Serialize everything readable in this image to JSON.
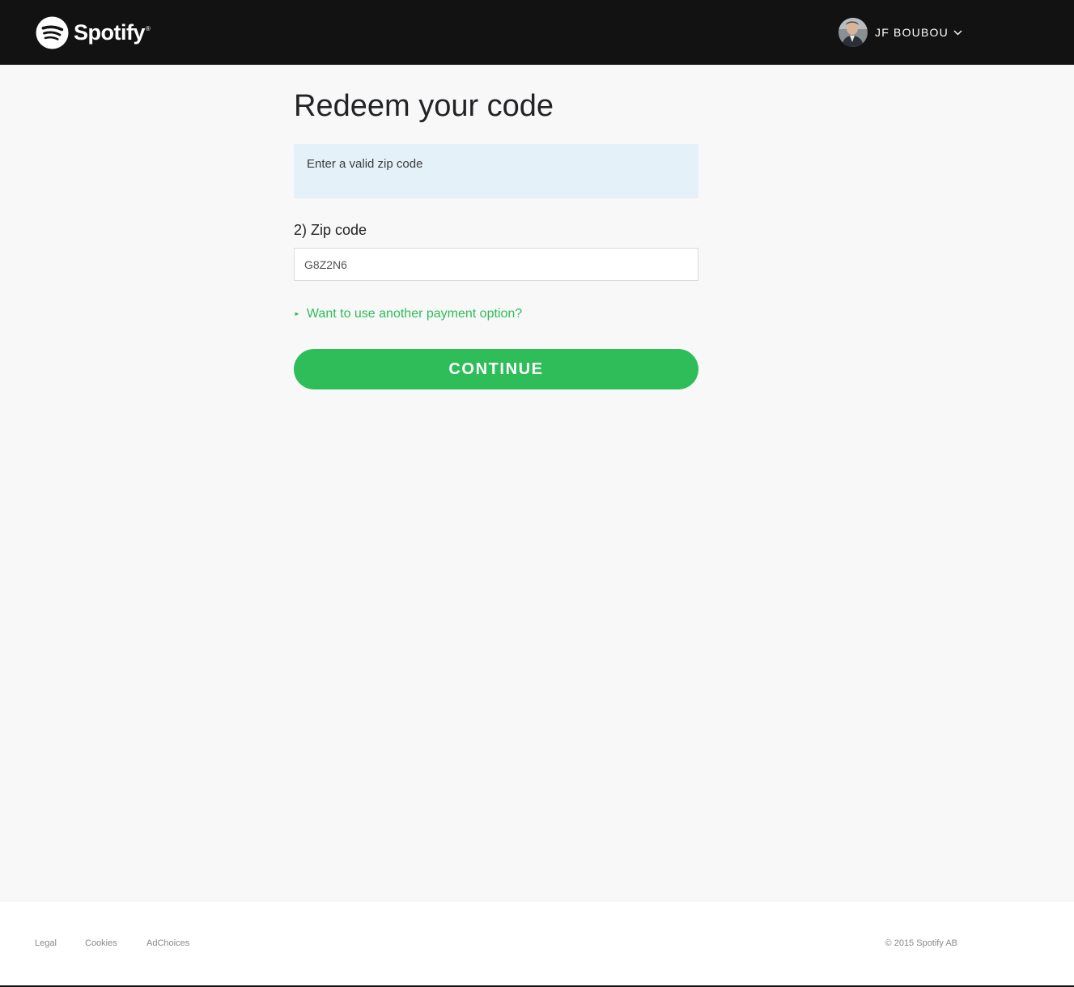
{
  "header": {
    "logo_text": "Spotify",
    "logo_mark": "®",
    "user": {
      "name": "JF BOUBOU"
    }
  },
  "main": {
    "title": "Redeem your code",
    "notice": "Enter a valid zip code",
    "zip_field": {
      "label": "2) Zip code",
      "value": "G8Z2N6"
    },
    "alt_payment_link": "Want to use another payment option?",
    "continue_label": "CONTINUE"
  },
  "footer": {
    "links": [
      "Legal",
      "Cookies",
      "AdChoices"
    ],
    "copyright": "© 2015 Spotify AB"
  },
  "colors": {
    "header_bg": "#121212",
    "page_bg": "#f8f8f8",
    "accent_green": "#2ebd59",
    "notice_bg": "#e5f1f9",
    "footer_text": "#88898c"
  }
}
